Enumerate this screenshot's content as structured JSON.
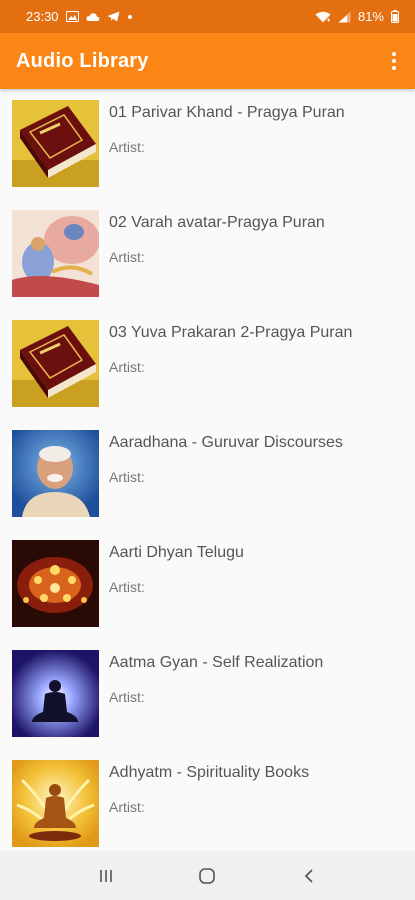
{
  "status_bar": {
    "time": "23:30",
    "battery": "81%",
    "left_icons": [
      "image-icon",
      "cloud-icon",
      "telegram-icon",
      "dot-icon"
    ],
    "right_icons": [
      "wifi-icon",
      "signal-icon",
      "battery-icon"
    ]
  },
  "app_bar": {
    "title": "Audio Library",
    "menu_icon": "overflow-menu-icon"
  },
  "items": [
    {
      "title": "01 Parivar Khand - Pragya Puran",
      "artist": "Artist:",
      "thumb": "book-image"
    },
    {
      "title": "02 Varah avatar-Pragya Puran",
      "artist": "Artist:",
      "thumb": "deity-painting-image"
    },
    {
      "title": "03 Yuva Prakaran 2-Pragya Puran",
      "artist": "Artist:",
      "thumb": "book-image"
    },
    {
      "title": "Aaradhana - Guruvar Discourses",
      "artist": "Artist:",
      "thumb": "guru-portrait-image"
    },
    {
      "title": "Aarti Dhyan Telugu",
      "artist": "Artist:",
      "thumb": "diya-lamps-image"
    },
    {
      "title": "Aatma Gyan - Self Realization",
      "artist": "Artist:",
      "thumb": "meditation-silhouette-image"
    },
    {
      "title": "Adhyatm - Spirituality Books",
      "artist": "Artist:",
      "thumb": "meditation-glow-image"
    }
  ],
  "nav_bar": [
    "recents-icon",
    "home-icon",
    "back-icon"
  ],
  "colors": {
    "app_bar": "#fb8616",
    "status_bar": "#e46f10",
    "background": "#fafafa"
  }
}
